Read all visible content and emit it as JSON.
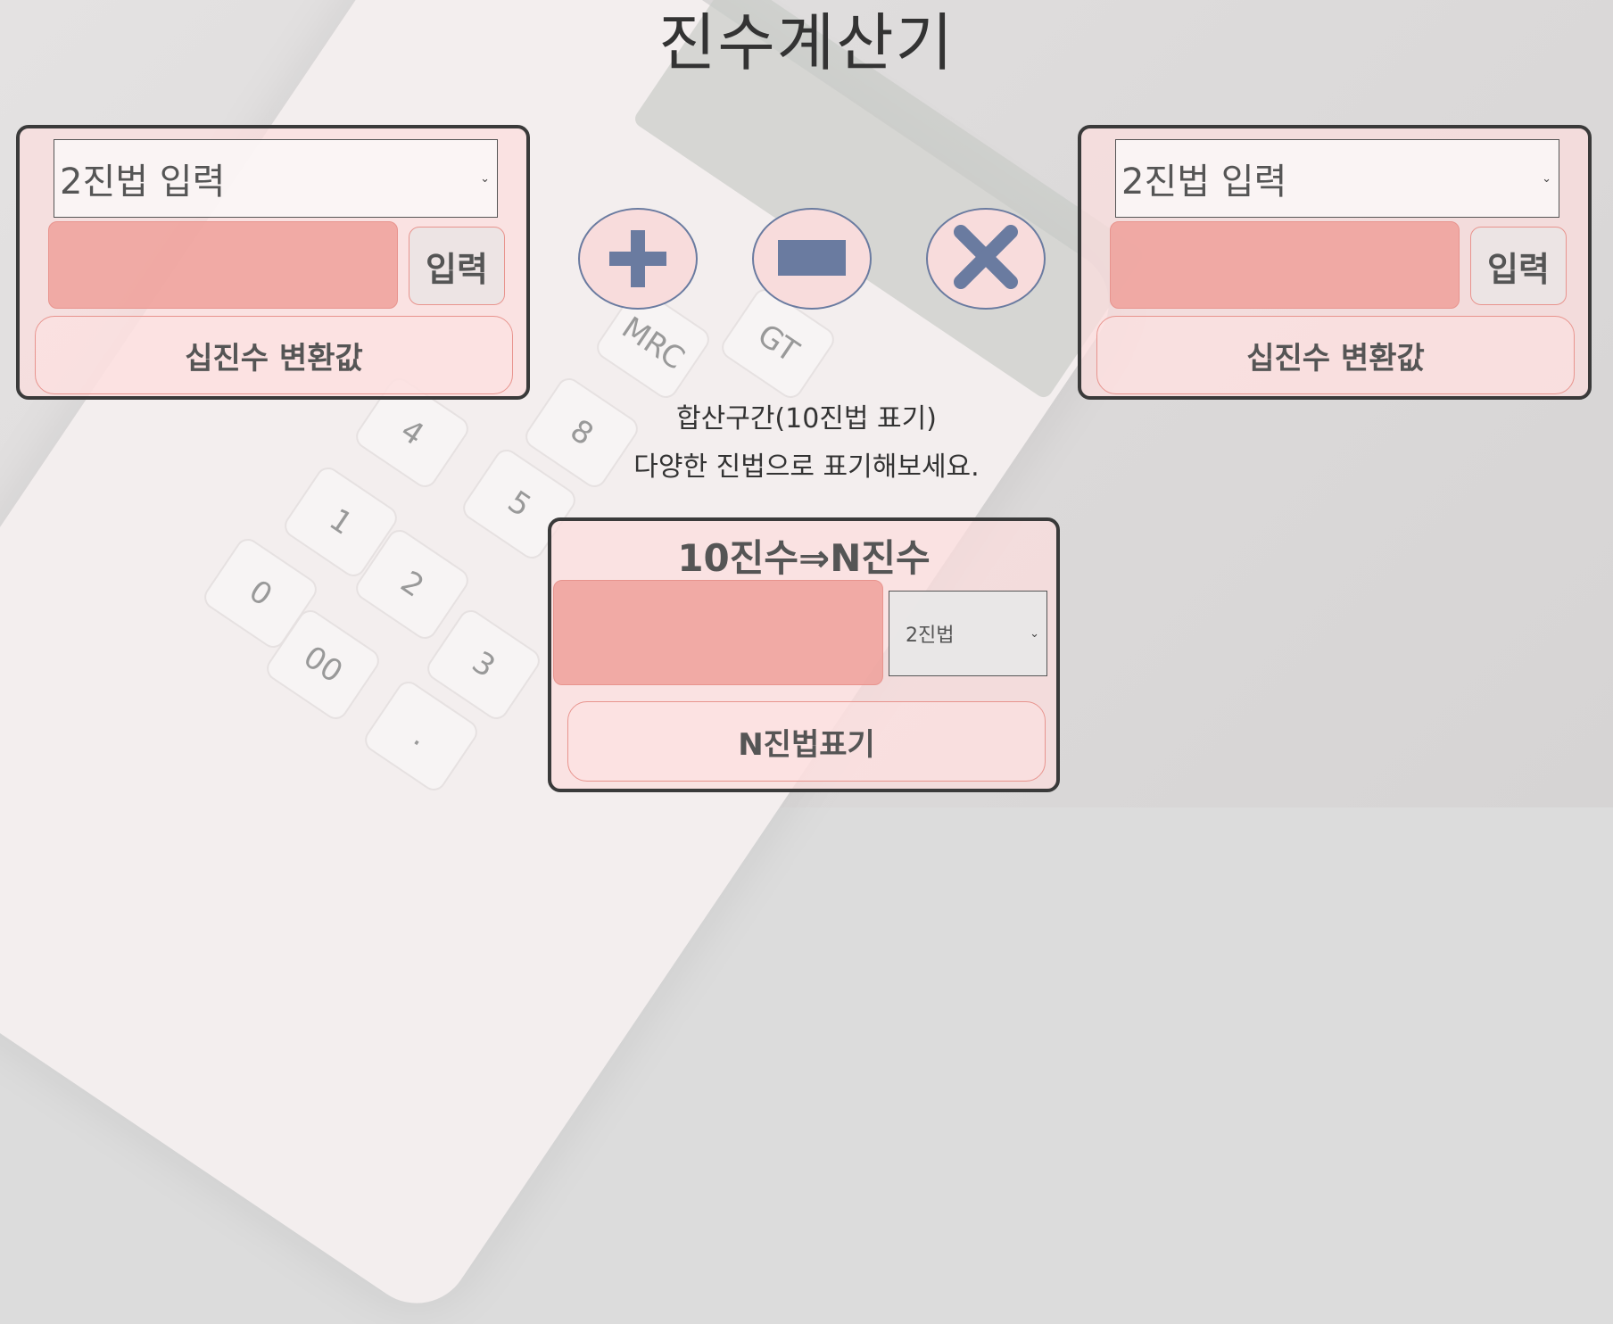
{
  "title": "진수계산기",
  "left_panel": {
    "base_select": "2진법 입력",
    "enter_label": "입력",
    "result_label": "십진수 변환값"
  },
  "right_panel": {
    "base_select": "2진법 입력",
    "enter_label": "입력",
    "result_label": "십진수 변환값"
  },
  "operators": [
    "plus-icon",
    "minus-icon",
    "multiply-icon"
  ],
  "info": {
    "line1": "합산구간(10진법 표기)",
    "line2": "다양한 진법으로 표기해보세요."
  },
  "convert_panel": {
    "title": "10진수⇒N진수",
    "base_select": "2진법",
    "result_label": "N진법표기"
  },
  "colors": {
    "panel_bg": "#fcdede",
    "input_fill": "#ef9c96",
    "operator_color": "#6a7ba0",
    "border": "#3a3a3a"
  }
}
